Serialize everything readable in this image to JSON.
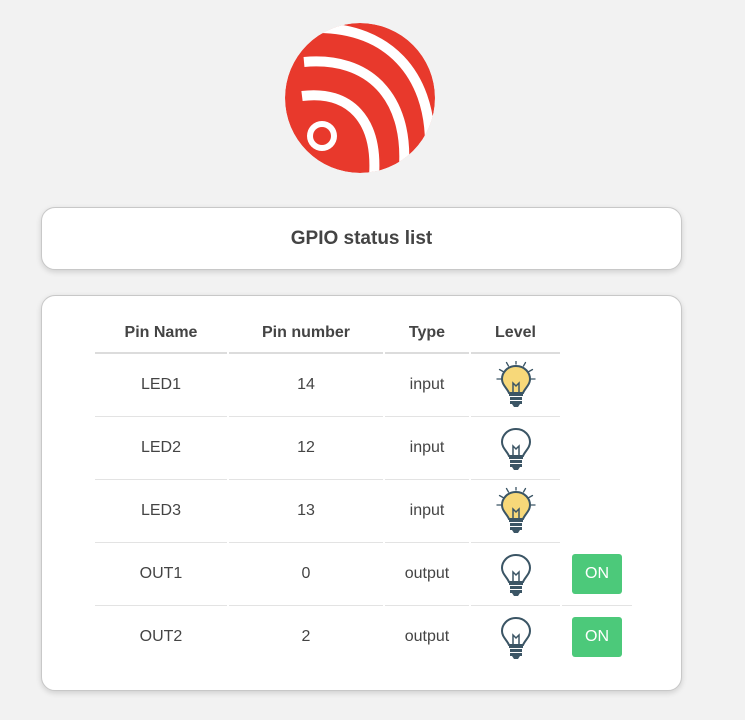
{
  "logo": {
    "icon": "espressif-logo"
  },
  "title": "GPIO status list",
  "table": {
    "headers": [
      "Pin Name",
      "Pin number",
      "Type",
      "Level"
    ],
    "rows": [
      {
        "name": "LED1",
        "pin": "14",
        "type": "input",
        "level": "on"
      },
      {
        "name": "LED2",
        "pin": "12",
        "type": "input",
        "level": "off"
      },
      {
        "name": "LED3",
        "pin": "13",
        "type": "input",
        "level": "on"
      },
      {
        "name": "OUT1",
        "pin": "0",
        "type": "output",
        "level": "off",
        "button": "ON"
      },
      {
        "name": "OUT2",
        "pin": "2",
        "type": "output",
        "level": "off",
        "button": "ON"
      }
    ]
  },
  "colors": {
    "logo_red": "#e8392c",
    "button_green": "#4cc97a",
    "bulb_on": "#f7d879",
    "bulb_off": "#3b5565"
  }
}
